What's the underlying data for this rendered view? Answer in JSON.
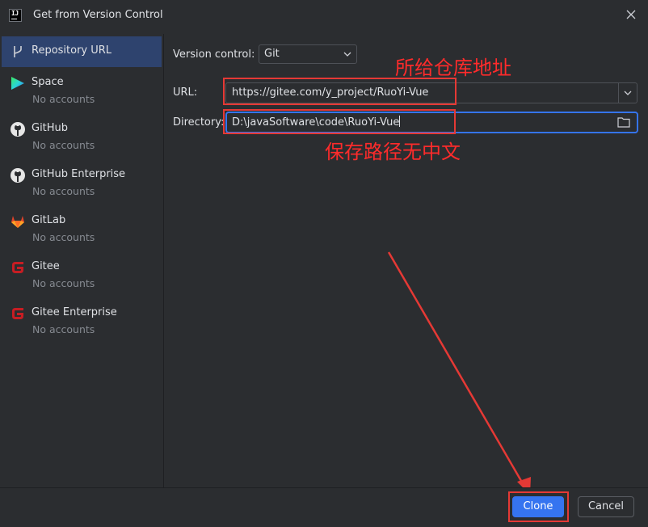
{
  "window": {
    "title": "Get from Version Control"
  },
  "sidebar": {
    "items": [
      {
        "label": "Repository URL",
        "sub": "",
        "icon": "vcs-branch-icon"
      },
      {
        "label": "Space",
        "sub": "No accounts",
        "icon": "space-icon"
      },
      {
        "label": "GitHub",
        "sub": "No accounts",
        "icon": "github-icon"
      },
      {
        "label": "GitHub Enterprise",
        "sub": "No accounts",
        "icon": "github-icon"
      },
      {
        "label": "GitLab",
        "sub": "No accounts",
        "icon": "gitlab-icon"
      },
      {
        "label": "Gitee",
        "sub": "No accounts",
        "icon": "gitee-icon"
      },
      {
        "label": "Gitee Enterprise",
        "sub": "No accounts",
        "icon": "gitee-icon"
      }
    ]
  },
  "form": {
    "version_control_label": "Version control:",
    "version_control_value": "Git",
    "url_label": "URL:",
    "url_value": "https://gitee.com/y_project/RuoYi-Vue",
    "directory_label": "Directory:",
    "directory_value": "D:\\javaSoftware\\code\\RuoYi-Vue"
  },
  "annotations": {
    "url_note": "所给仓库地址",
    "directory_note": "保存路径无中文"
  },
  "buttons": {
    "clone": "Clone",
    "cancel": "Cancel"
  },
  "colors": {
    "accent": "#3574f0",
    "annotation": "#e53935",
    "selection": "#2e436e"
  }
}
